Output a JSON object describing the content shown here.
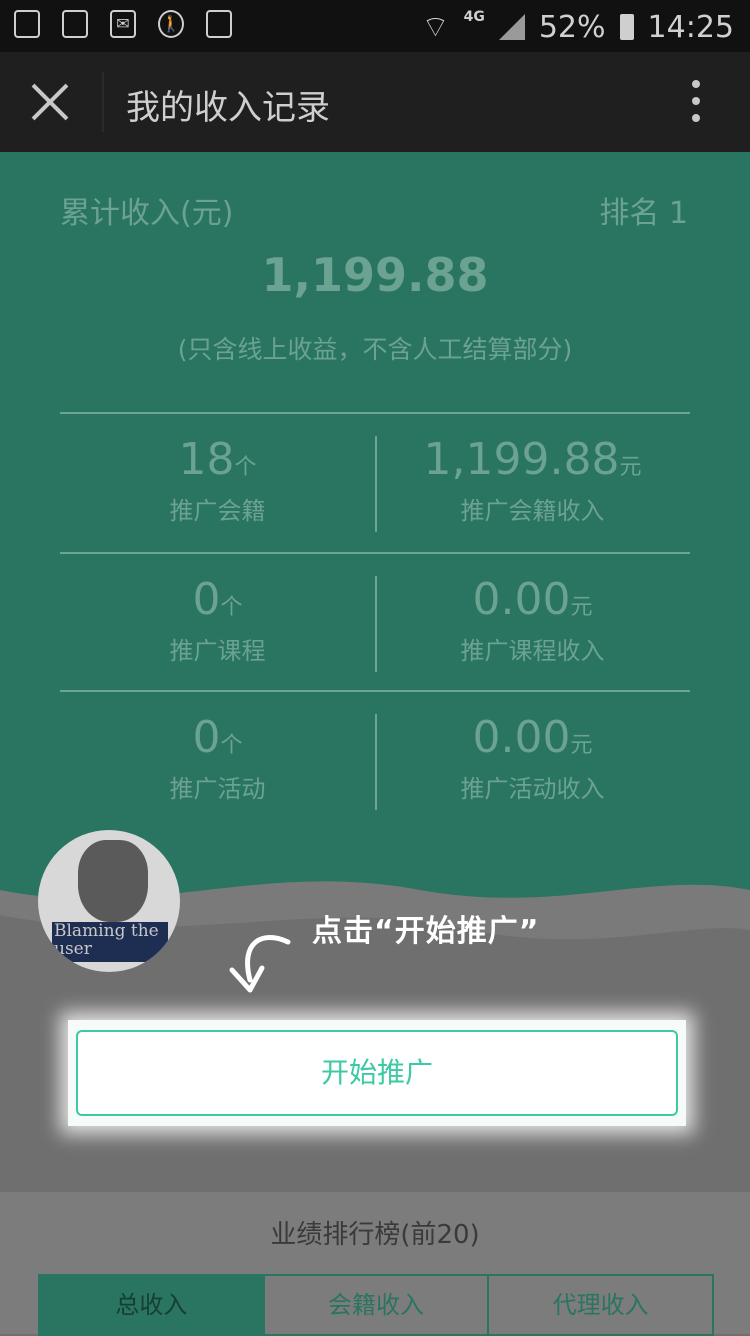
{
  "statusbar": {
    "network": "4G",
    "battery": "52%",
    "time": "14:25"
  },
  "nav": {
    "title": "我的收入记录"
  },
  "summary": {
    "total_label": "累计收入(元)",
    "rank_label": "排名 1",
    "total_amount": "1,199.88",
    "note": "(只含线上收益，不含人工结算部分)"
  },
  "stats": [
    {
      "left_num": "18",
      "left_unit": "个",
      "left_label": "推广会籍",
      "right_num": "1,199.88",
      "right_unit": "元",
      "right_label": "推广会籍收入"
    },
    {
      "left_num": "0",
      "left_unit": "个",
      "left_label": "推广课程",
      "right_num": "0.00",
      "right_unit": "元",
      "right_label": "推广课程收入"
    },
    {
      "left_num": "0",
      "left_unit": "个",
      "left_label": "推广活动",
      "right_num": "0.00",
      "right_unit": "元",
      "right_label": "推广活动收入"
    }
  ],
  "avatar": {
    "caption": "Blaming the user"
  },
  "hint": "点击“开始推广”",
  "cta": {
    "label": "开始推广"
  },
  "board": {
    "title": "业绩排行榜(前20)",
    "tabs": [
      "总收入",
      "会籍收入",
      "代理收入"
    ]
  }
}
